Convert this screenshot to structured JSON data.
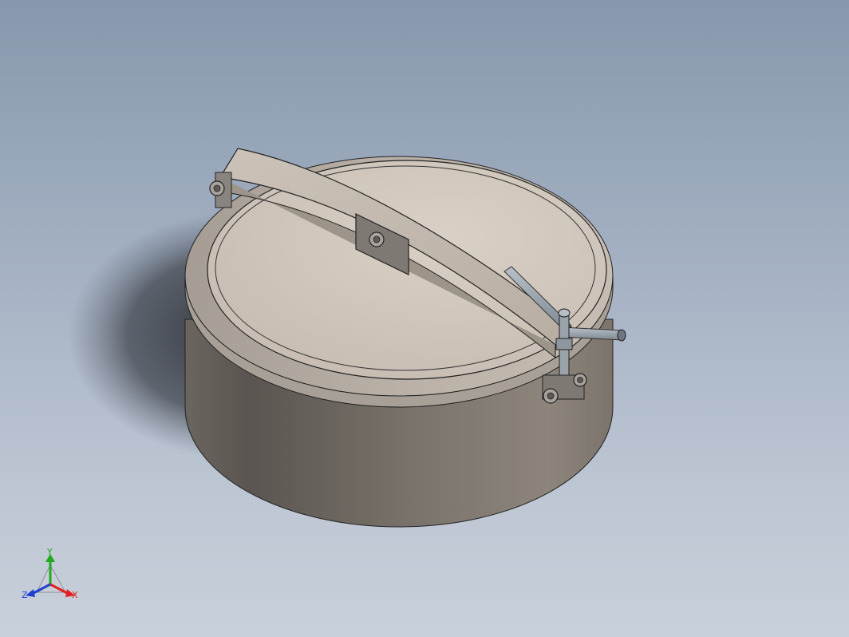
{
  "viewport": {
    "background_top": "#8797ad",
    "background_bottom": "#c8d0db"
  },
  "model": {
    "body_color": "#8a8178",
    "lid_color": "#cfc6bc",
    "handle_color": "#9aa3ad",
    "hardware_color": "#6f6a66"
  },
  "triad": {
    "x_label": "X",
    "y_label": "Y",
    "z_label": "Z",
    "x_color": "#e02020",
    "y_color": "#1faa1f",
    "z_color": "#2040d0"
  }
}
